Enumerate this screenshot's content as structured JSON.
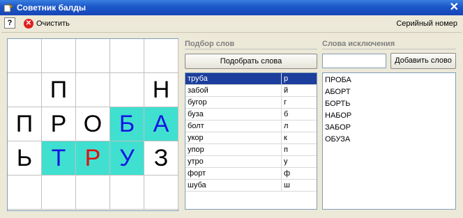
{
  "window": {
    "title": "Советник балды",
    "icon": "app-icon",
    "close": "✕"
  },
  "toolbar": {
    "help_label": "?",
    "clear_label": "Очистить",
    "serial_label": "Серийный номер"
  },
  "grid": {
    "rows": [
      [
        {
          "ch": ""
        },
        {
          "ch": ""
        },
        {
          "ch": ""
        },
        {
          "ch": ""
        },
        {
          "ch": ""
        }
      ],
      [
        {
          "ch": ""
        },
        {
          "ch": "П"
        },
        {
          "ch": ""
        },
        {
          "ch": ""
        },
        {
          "ch": "Н"
        }
      ],
      [
        {
          "ch": "П"
        },
        {
          "ch": "Р"
        },
        {
          "ch": "О"
        },
        {
          "ch": "Б",
          "hl": true,
          "color": "blue"
        },
        {
          "ch": "А",
          "hl": true,
          "color": "blue"
        }
      ],
      [
        {
          "ch": "Ь"
        },
        {
          "ch": "Т",
          "hl": true,
          "color": "blue"
        },
        {
          "ch": "Р",
          "hl": true,
          "color": "red"
        },
        {
          "ch": "У",
          "hl": true,
          "color": "blue"
        },
        {
          "ch": "З"
        }
      ],
      [
        {
          "ch": ""
        },
        {
          "ch": ""
        },
        {
          "ch": ""
        },
        {
          "ch": ""
        },
        {
          "ch": ""
        }
      ]
    ],
    "highlight_color": "#40e0d0"
  },
  "word_pick": {
    "label": "Подбор слов",
    "button_label": "Подобрать слова",
    "rows": [
      {
        "word": "труба",
        "letter": "р",
        "selected": true
      },
      {
        "word": "забой",
        "letter": "й"
      },
      {
        "word": "бугор",
        "letter": "г"
      },
      {
        "word": "буза",
        "letter": "б"
      },
      {
        "word": "болт",
        "letter": "л"
      },
      {
        "word": "укор",
        "letter": "к"
      },
      {
        "word": "упор",
        "letter": "п"
      },
      {
        "word": "утро",
        "letter": "у"
      },
      {
        "word": "форт",
        "letter": "ф"
      },
      {
        "word": "шуба",
        "letter": "ш"
      }
    ]
  },
  "exclusions": {
    "label": "Слова исключения",
    "input_value": "",
    "add_button_label": "Добавить слово",
    "items": [
      "ПРОБА",
      "АБОРТ",
      "БОРТЬ",
      "НАБОР",
      "ЗАБОР",
      "ОБУЗА"
    ]
  }
}
